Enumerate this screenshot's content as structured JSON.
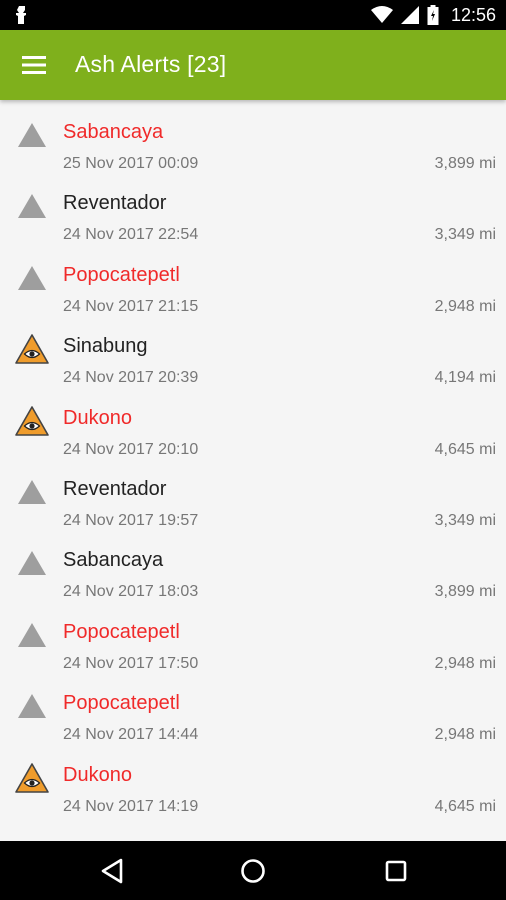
{
  "status_bar": {
    "time": "12:56",
    "icons": [
      "notification-icon",
      "wifi-icon",
      "cell-signal-icon",
      "battery-icon"
    ]
  },
  "app_bar": {
    "title": "Ash Alerts [23]",
    "color": "#7fb01c",
    "menu_icon": "hamburger-menu-icon"
  },
  "colors": {
    "alert_name": "#f02a2a",
    "normal_name": "#222222",
    "meta": "#777777",
    "gray_triangle": "#9e9e9e",
    "orange_triangle": "#ef9c2c"
  },
  "alerts": [
    {
      "name": "Sabancaya",
      "date": "25 Nov 2017 00:09",
      "distance": "3,899 mi",
      "highlight": true,
      "icon": "gray-triangle-icon"
    },
    {
      "name": "Reventador",
      "date": "24 Nov 2017 22:54",
      "distance": "3,349 mi",
      "highlight": false,
      "icon": "gray-triangle-icon"
    },
    {
      "name": "Popocatepetl",
      "date": "24 Nov 2017 21:15",
      "distance": "2,948 mi",
      "highlight": true,
      "icon": "gray-triangle-icon"
    },
    {
      "name": "Sinabung",
      "date": "24 Nov 2017 20:39",
      "distance": "4,194 mi",
      "highlight": false,
      "icon": "orange-eye-triangle-icon"
    },
    {
      "name": "Dukono",
      "date": "24 Nov 2017 20:10",
      "distance": "4,645 mi",
      "highlight": true,
      "icon": "orange-eye-triangle-icon"
    },
    {
      "name": "Reventador",
      "date": "24 Nov 2017 19:57",
      "distance": "3,349 mi",
      "highlight": false,
      "icon": "gray-triangle-icon"
    },
    {
      "name": "Sabancaya",
      "date": "24 Nov 2017 18:03",
      "distance": "3,899 mi",
      "highlight": false,
      "icon": "gray-triangle-icon"
    },
    {
      "name": "Popocatepetl",
      "date": "24 Nov 2017 17:50",
      "distance": "2,948 mi",
      "highlight": true,
      "icon": "gray-triangle-icon"
    },
    {
      "name": "Popocatepetl",
      "date": "24 Nov 2017 14:44",
      "distance": "2,948 mi",
      "highlight": true,
      "icon": "gray-triangle-icon"
    },
    {
      "name": "Dukono",
      "date": "24 Nov 2017 14:19",
      "distance": "4,645 mi",
      "highlight": true,
      "icon": "orange-eye-triangle-icon"
    }
  ],
  "nav_bar": {
    "buttons": [
      "back-icon",
      "home-icon",
      "recents-icon"
    ]
  }
}
